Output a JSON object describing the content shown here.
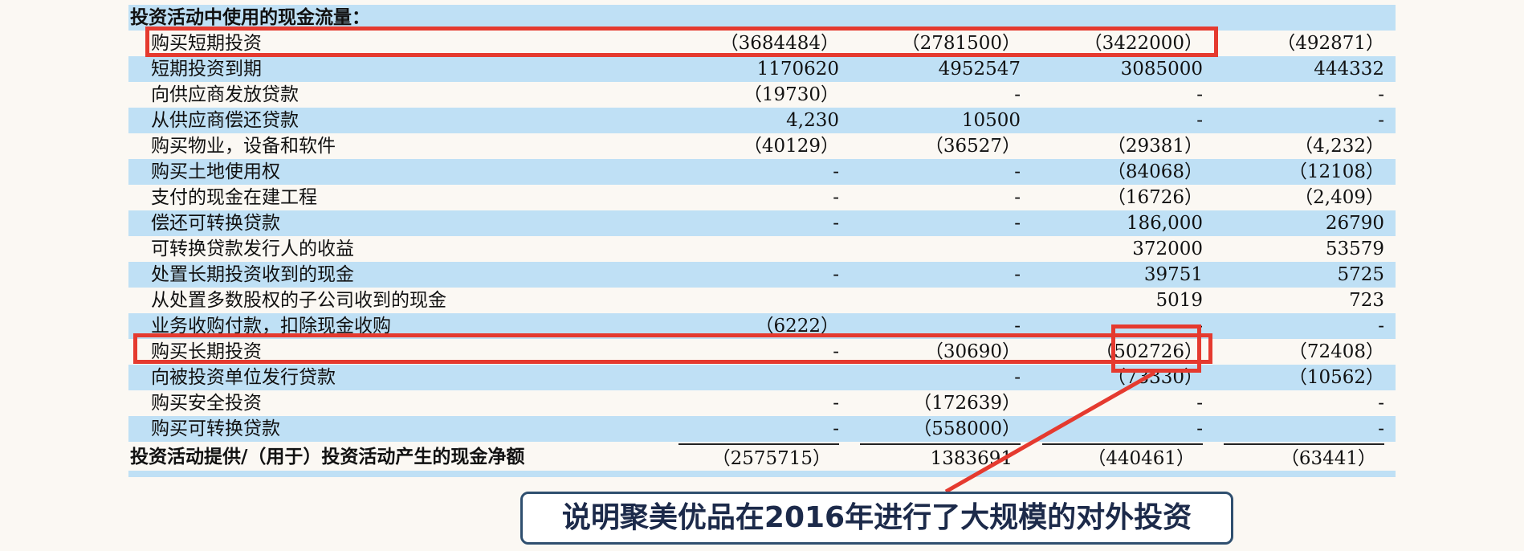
{
  "statement": {
    "header": "投资活动中使用的现金流量：",
    "rows": [
      {
        "label": "购买短期投资",
        "values": [
          "（3684484）",
          "（2781500）",
          "（3422000）",
          "（492871）"
        ]
      },
      {
        "label": "短期投资到期",
        "values": [
          "1170620",
          "4952547",
          "3085000",
          "444332"
        ]
      },
      {
        "label": "向供应商发放贷款",
        "values": [
          "（19730）",
          "-",
          "-",
          "-"
        ]
      },
      {
        "label": "从供应商偿还贷款",
        "values": [
          "4,230",
          "10500",
          "-",
          "-"
        ]
      },
      {
        "label": "购买物业，设备和软件",
        "values": [
          "（40129）",
          "（36527）",
          "（29381）",
          "（4,232）"
        ]
      },
      {
        "label": "购买土地使用权",
        "values": [
          "-",
          "-",
          "（84068）",
          "（12108）"
        ]
      },
      {
        "label": "支付的现金在建工程",
        "values": [
          "-",
          "-",
          "（16726）",
          "（2,409）"
        ]
      },
      {
        "label": "偿还可转换贷款",
        "values": [
          "-",
          "-",
          "186,000",
          "26790"
        ]
      },
      {
        "label": "可转换贷款发行人的收益",
        "values": [
          "",
          "",
          "372000",
          "53579"
        ]
      },
      {
        "label": "处置长期投资收到的现金",
        "values": [
          "-",
          "-",
          "39751",
          "5725"
        ]
      },
      {
        "label": "从处置多数股权的子公司收到的现金",
        "values": [
          "",
          "",
          "5019",
          "723"
        ]
      },
      {
        "label": "业务收购付款，扣除现金收购",
        "values": [
          "（6222）",
          "-",
          "-",
          "-"
        ]
      },
      {
        "label": "购买长期投资",
        "values": [
          "-",
          "（30690）",
          "（502726）",
          "（72408）"
        ]
      },
      {
        "label": "向被投资单位发行贷款",
        "values": [
          "",
          "-",
          "（73330）",
          "（10562）"
        ]
      },
      {
        "label": "购买安全投资",
        "values": [
          "-",
          "（172639）",
          "-",
          "-"
        ]
      },
      {
        "label": "购买可转换贷款",
        "values": [
          "-",
          "（558000）",
          "-",
          "-"
        ]
      }
    ],
    "total": {
      "label": "投资活动提供/（用于）投资活动产生的现金净额",
      "values": [
        "（2575715）",
        "1383691",
        "（440461）",
        "（63441）"
      ]
    }
  },
  "annotation": {
    "caption": "说明聚美优品在2016年进行了大规模的对外投资",
    "highlight_color": "#e53a2f",
    "row_shade_color": "#bfe0f5"
  }
}
